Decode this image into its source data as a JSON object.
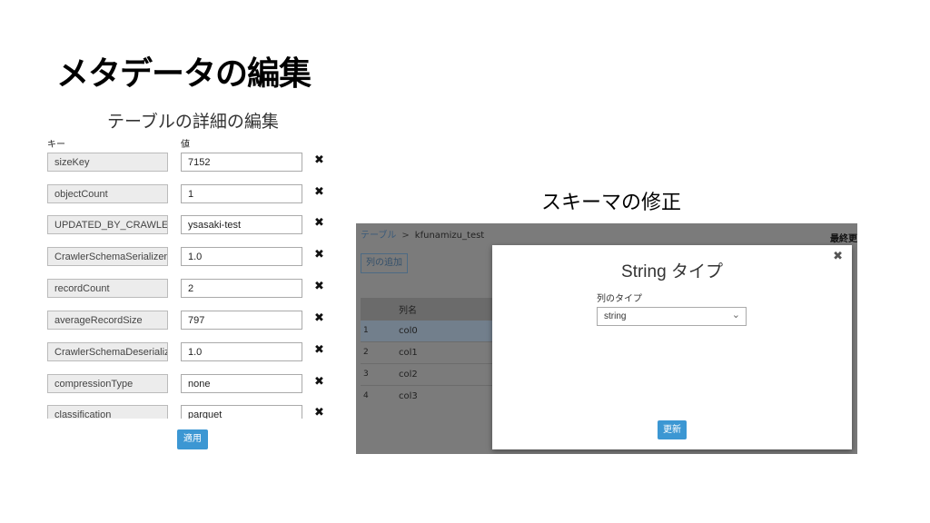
{
  "slide": {
    "title": "メタデータの編集",
    "right_caption": "スキーマの修正"
  },
  "edit_panel": {
    "heading": "テーブルの詳細の編集",
    "key_header": "キー",
    "value_header": "値",
    "rows": [
      {
        "key": "sizeKey",
        "value": "7152"
      },
      {
        "key": "objectCount",
        "value": "1"
      },
      {
        "key": "UPDATED_BY_CRAWLER",
        "value": "ysasaki-test"
      },
      {
        "key": "CrawlerSchemaSerializerVer",
        "value": "1.0"
      },
      {
        "key": "recordCount",
        "value": "2"
      },
      {
        "key": "averageRecordSize",
        "value": "797"
      },
      {
        "key": "CrawlerSchemaDeserializerV",
        "value": "1.0"
      },
      {
        "key": "compressionType",
        "value": "none"
      },
      {
        "key": "classification",
        "value": "parquet"
      }
    ],
    "delete_glyph": "✖",
    "apply_label": "適用"
  },
  "schema_view": {
    "breadcrumb": {
      "root": "テーブル",
      "separator": ">",
      "current": "kfunamizu_test"
    },
    "top_right_text": "最終更",
    "add_column_label": "列の追加",
    "column_header": "列名",
    "columns": [
      {
        "num": "1",
        "name": "col0"
      },
      {
        "num": "2",
        "name": "col1"
      },
      {
        "num": "3",
        "name": "col2"
      },
      {
        "num": "4",
        "name": "col3"
      }
    ],
    "modal": {
      "title": "String タイプ",
      "close_glyph": "✖",
      "field_label": "列のタイプ",
      "selected_type": "string",
      "update_label": "更新"
    }
  }
}
